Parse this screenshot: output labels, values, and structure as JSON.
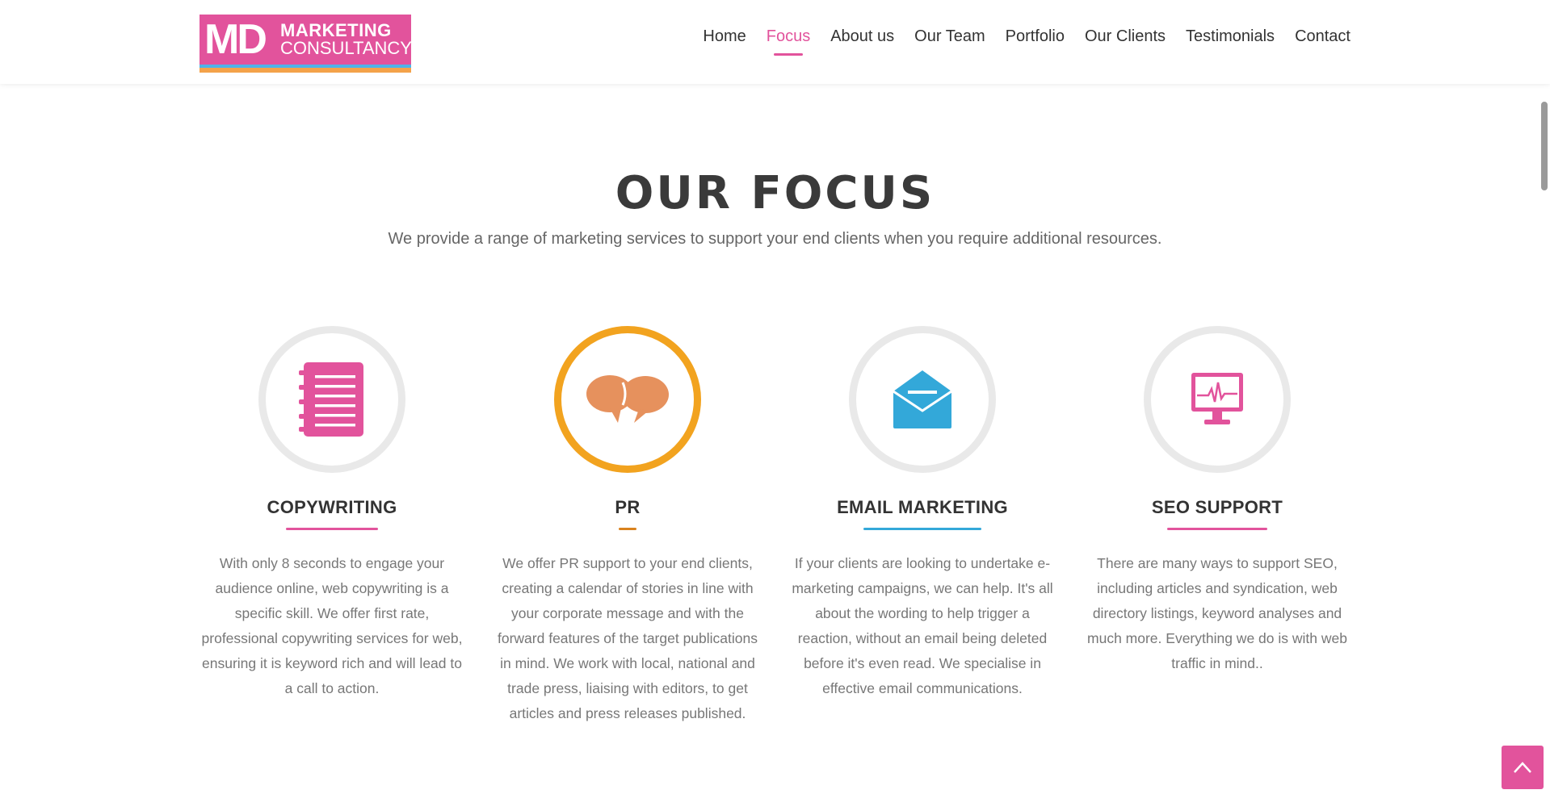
{
  "brand": {
    "logo_mark": "MD",
    "logo_line1": "MARKETING",
    "logo_line2": "CONSULTANCY"
  },
  "nav": {
    "items": [
      {
        "label": "Home",
        "active": false
      },
      {
        "label": "Focus",
        "active": true
      },
      {
        "label": "About us",
        "active": false
      },
      {
        "label": "Our Team",
        "active": false
      },
      {
        "label": "Portfolio",
        "active": false
      },
      {
        "label": "Our Clients",
        "active": false
      },
      {
        "label": "Testimonials",
        "active": false
      },
      {
        "label": "Contact",
        "active": false
      }
    ]
  },
  "section": {
    "title": "OUR FOCUS",
    "subtitle": "We provide a range of marketing services to support your end clients when you require additional resources."
  },
  "cards": [
    {
      "title": "COPYWRITING",
      "icon": "notebook-icon",
      "accent": "#e2539c",
      "body": "With only 8 seconds to engage your audience online, web copywriting is a specific skill. We offer first rate, professional copywriting services for web, ensuring it is keyword rich and will lead to a call to action."
    },
    {
      "title": "PR",
      "icon": "speech-bubbles-icon",
      "accent": "#d9821e",
      "body": "We offer PR support to your end clients, creating a calendar of stories in line with your corporate message and with the forward features of the target publications in mind. We work with local, national and trade press, liaising with editors, to get articles and press releases published."
    },
    {
      "title": "EMAIL MARKETING",
      "icon": "envelope-icon",
      "accent": "#33a8d9",
      "body": "If your clients are looking to undertake e-marketing campaigns, we can help. It's all about the wording to help trigger a reaction, without an email being deleted before it's even read. We specialise in effective email communications."
    },
    {
      "title": "SEO SUPPORT",
      "icon": "monitor-pulse-icon",
      "accent": "#e2539c",
      "body": "There are many ways to support SEO, including articles and syndication, web directory listings, keyword analyses and much more. Everything we do is with web traffic in mind.."
    }
  ],
  "colors": {
    "brand_pink": "#e2539c",
    "highlight_orange": "#f2a31f",
    "email_blue": "#33a8d9"
  }
}
